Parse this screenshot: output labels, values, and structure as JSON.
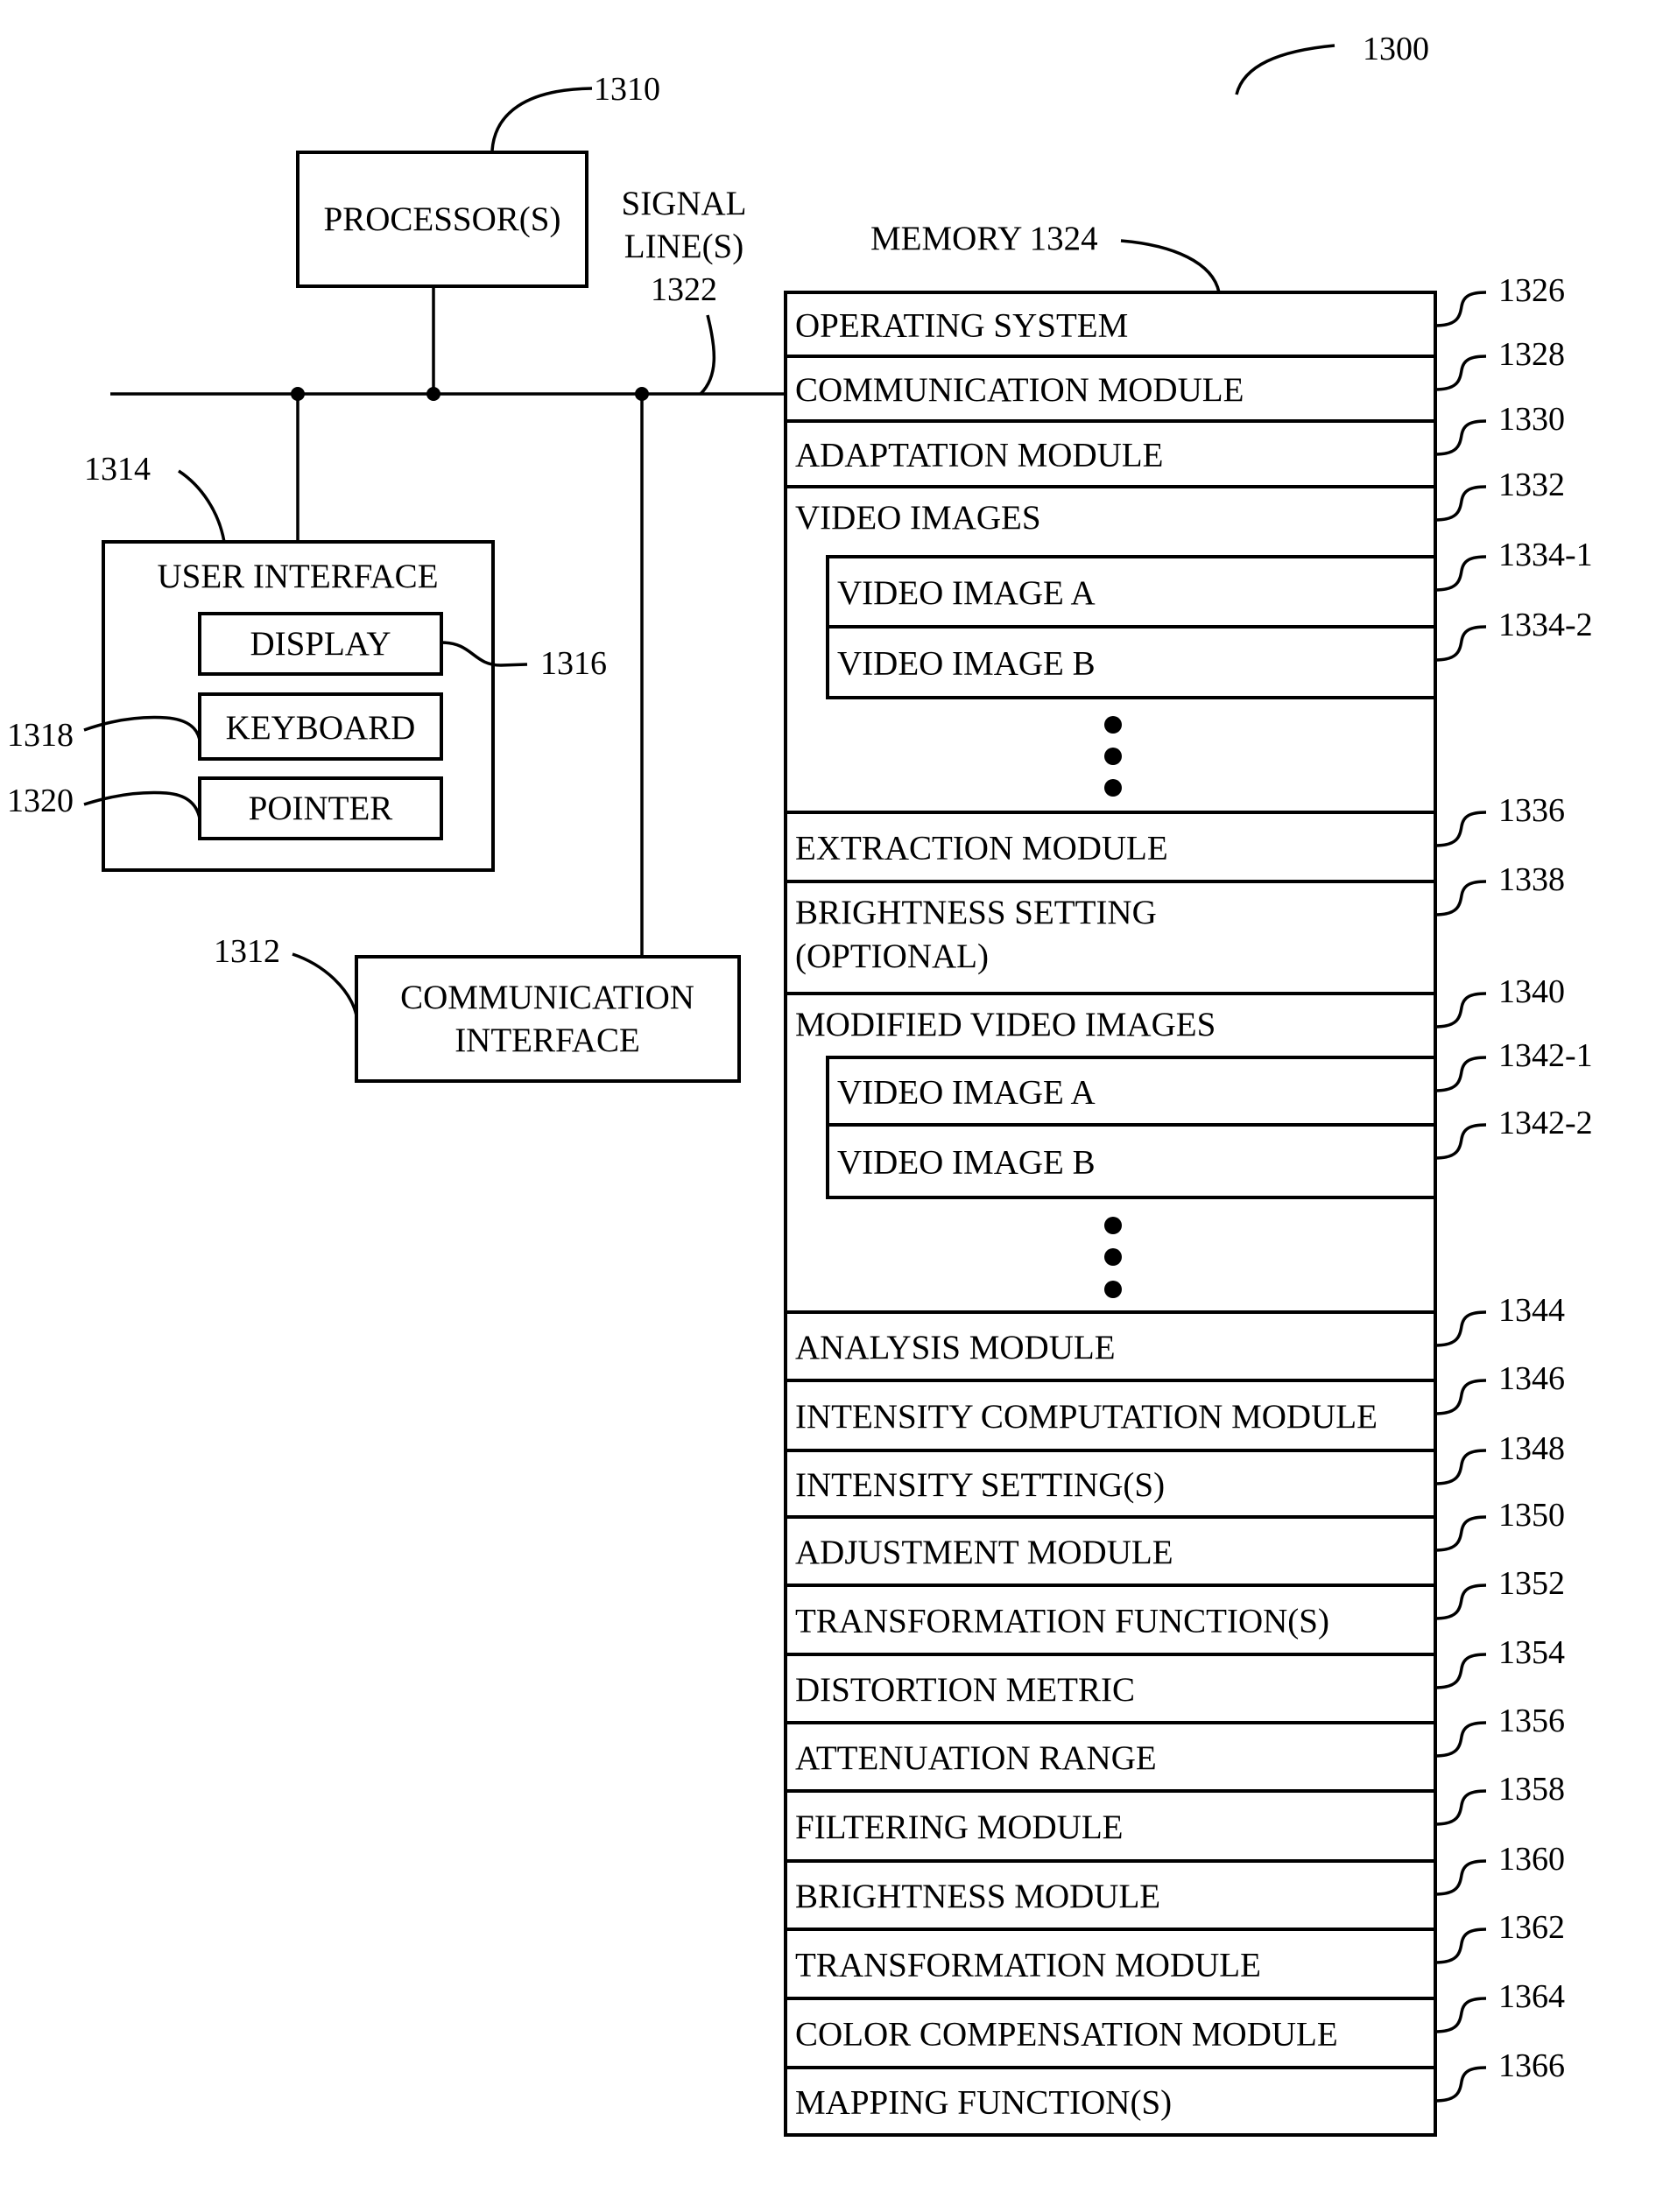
{
  "figure": {
    "ref": "1300"
  },
  "processor": {
    "label": "PROCESSOR(S)",
    "ref": "1310"
  },
  "signal_lines": {
    "line1": "SIGNAL",
    "line2": "LINE(S)",
    "ref": "1322"
  },
  "user_interface": {
    "label": "USER INTERFACE",
    "ref": "1314",
    "display": {
      "label": "DISPLAY",
      "ref": "1316"
    },
    "keyboard": {
      "label": "KEYBOARD",
      "ref": "1318"
    },
    "pointer": {
      "label": "POINTER",
      "ref": "1320"
    }
  },
  "communication_interface": {
    "line1": "COMMUNICATION",
    "line2": "INTERFACE",
    "ref": "1312"
  },
  "memory": {
    "label": "MEMORY 1324",
    "rows": [
      {
        "label": "OPERATING SYSTEM",
        "ref": "1326"
      },
      {
        "label": "COMMUNICATION MODULE",
        "ref": "1328"
      },
      {
        "label": "ADAPTATION MODULE",
        "ref": "1330"
      },
      {
        "label": "VIDEO IMAGES",
        "ref": "1332"
      },
      {
        "label": "VIDEO IMAGE A",
        "ref": "1334-1"
      },
      {
        "label": "VIDEO IMAGE B",
        "ref": "1334-2"
      },
      {
        "label": "EXTRACTION MODULE",
        "ref": "1336"
      },
      {
        "label": "BRIGHTNESS SETTING",
        "label2": "(OPTIONAL)",
        "ref": "1338"
      },
      {
        "label": "MODIFIED VIDEO IMAGES",
        "ref": "1340"
      },
      {
        "label": "VIDEO IMAGE A",
        "ref": "1342-1"
      },
      {
        "label": "VIDEO IMAGE B",
        "ref": "1342-2"
      },
      {
        "label": "ANALYSIS MODULE",
        "ref": "1344"
      },
      {
        "label": "INTENSITY COMPUTATION MODULE",
        "ref": "1346"
      },
      {
        "label": "INTENSITY SETTING(S)",
        "ref": "1348"
      },
      {
        "label": "ADJUSTMENT MODULE",
        "ref": "1350"
      },
      {
        "label": "TRANSFORMATION FUNCTION(S)",
        "ref": "1352"
      },
      {
        "label": "DISTORTION METRIC",
        "ref": "1354"
      },
      {
        "label": "ATTENUATION RANGE",
        "ref": "1356"
      },
      {
        "label": "FILTERING MODULE",
        "ref": "1358"
      },
      {
        "label": "BRIGHTNESS MODULE",
        "ref": "1360"
      },
      {
        "label": "TRANSFORMATION MODULE",
        "ref": "1362"
      },
      {
        "label": "COLOR COMPENSATION MODULE",
        "ref": "1364"
      },
      {
        "label": "MAPPING FUNCTION(S)",
        "ref": "1366"
      }
    ]
  }
}
